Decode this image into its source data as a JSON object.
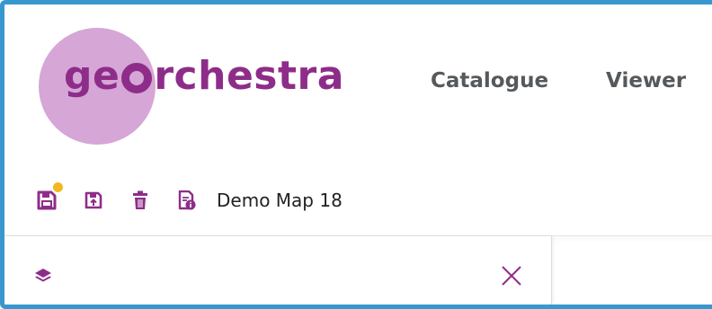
{
  "brand": {
    "logo_prefix": "ge",
    "logo_suffix": "rchestra",
    "colors": {
      "primary": "#8e2d89",
      "circle": "#d6a6d6",
      "frame_border": "#3798cf",
      "badge_dot": "#f3b81e"
    }
  },
  "nav": {
    "items": [
      {
        "label": "Catalogue"
      },
      {
        "label": "Viewer"
      }
    ]
  },
  "toolbar": {
    "icons": [
      "save-icon",
      "save-as-icon",
      "delete-icon",
      "map-info-icon"
    ],
    "map_title": "Demo Map 18"
  },
  "panel": {
    "icons": [
      "layers-icon",
      "close-icon"
    ]
  }
}
